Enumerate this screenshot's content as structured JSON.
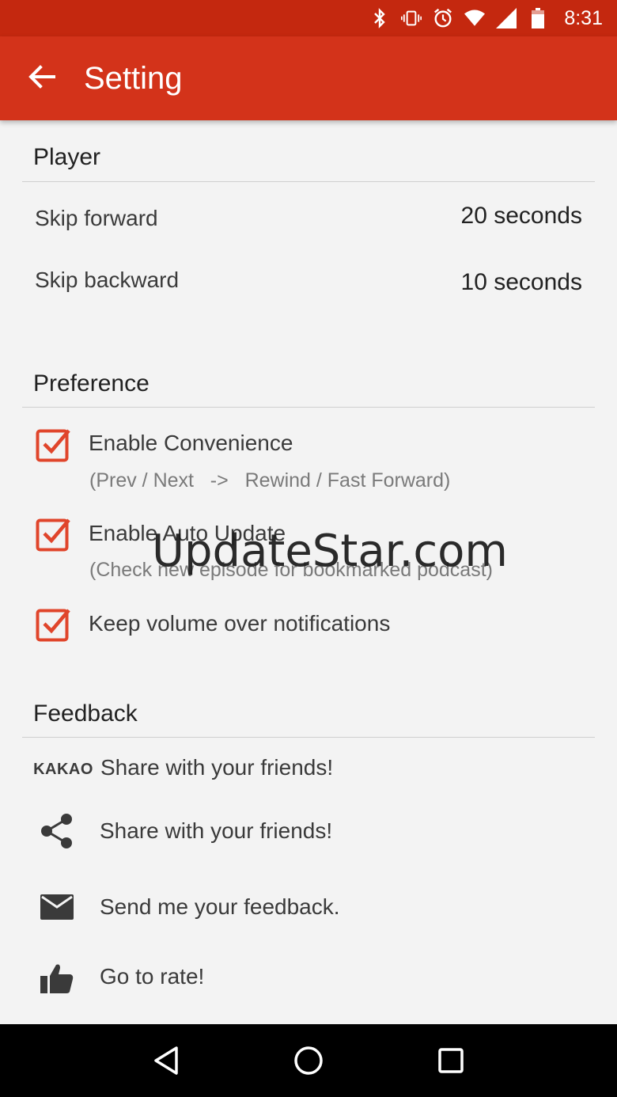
{
  "status_bar": {
    "time": "8:31",
    "icons": [
      "bluetooth-icon",
      "vibrate-icon",
      "alarm-icon",
      "wifi-icon",
      "signal-icon",
      "battery-icon"
    ]
  },
  "app_bar": {
    "title": "Setting",
    "back_icon": "arrow-back-icon"
  },
  "sections": {
    "player": {
      "header": "Player",
      "skip_forward_label": "Skip forward",
      "skip_forward_value": "20 seconds",
      "skip_backward_label": "Skip backward",
      "skip_backward_value": "10 seconds"
    },
    "preference": {
      "header": "Preference",
      "items": [
        {
          "label": "Enable Convenience",
          "sub": "(Prev / Next   ->   Rewind / Fast Forward)",
          "checked": true
        },
        {
          "label": "Enable Auto Update",
          "sub": "(Check new episode for bookmarked podcast)",
          "checked": true
        },
        {
          "label": "Keep volume over notifications",
          "checked": true
        }
      ]
    },
    "feedback": {
      "header": "Feedback",
      "items": [
        {
          "icon": "kakao-logo",
          "kakao_text": "KAKAO",
          "label": "Share with your friends!"
        },
        {
          "icon": "share-icon",
          "label": "Share with your friends!"
        },
        {
          "icon": "mail-icon",
          "label": "Send me your feedback."
        },
        {
          "icon": "thumbs-up-icon",
          "label": "Go to rate!"
        }
      ]
    }
  },
  "watermark": "UpdateStar.com",
  "colors": {
    "status_bar": "#c4280f",
    "app_bar": "#d3331a",
    "accent": "#e0452b",
    "background": "#f3f3f3"
  },
  "nav_bar": {
    "buttons": [
      "back-triangle-icon",
      "home-circle-icon",
      "recents-square-icon"
    ]
  }
}
